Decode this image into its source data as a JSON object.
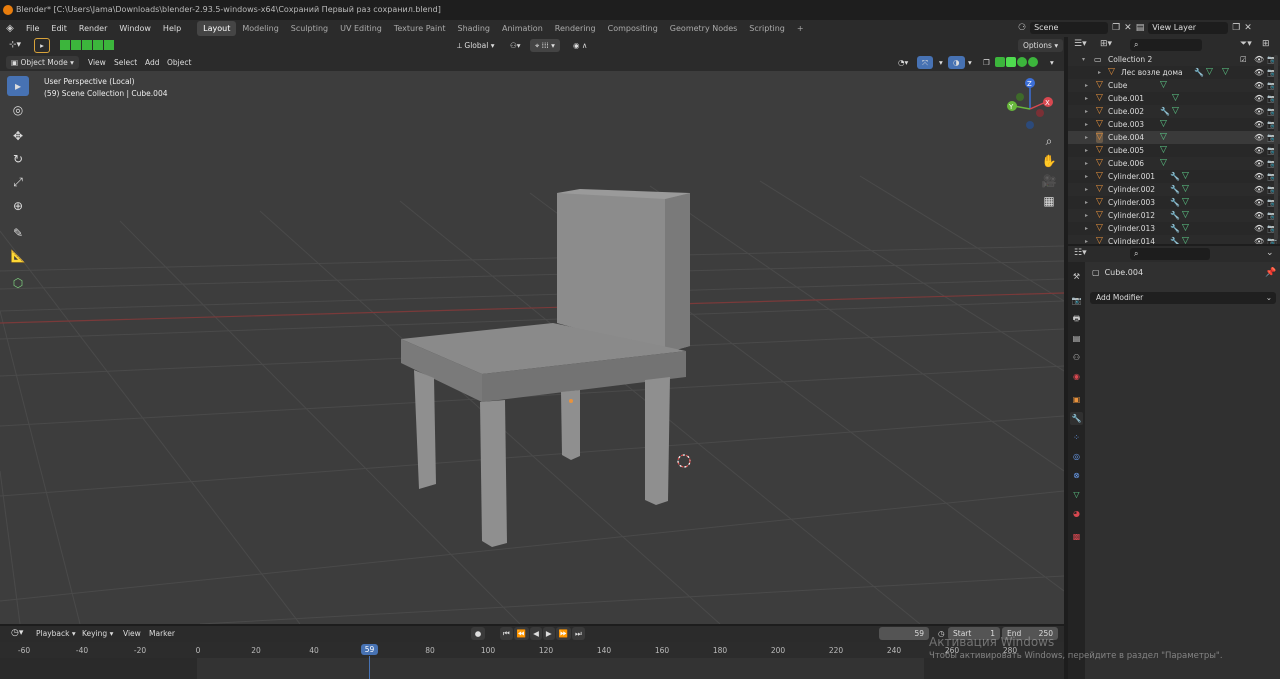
{
  "window": {
    "title": "Blender* [C:\\Users\\Jama\\Downloads\\blender-2.93.5-windows-x64\\Сохраний Первый раз сохранил.blend]"
  },
  "menubar": {
    "menus": [
      "File",
      "Edit",
      "Render",
      "Window",
      "Help"
    ],
    "workspaces": [
      "Layout",
      "Modeling",
      "Sculpting",
      "UV Editing",
      "Texture Paint",
      "Shading",
      "Animation",
      "Rendering",
      "Compositing",
      "Geometry Nodes",
      "Scripting"
    ],
    "active_workspace": "Layout",
    "scene": "Scene",
    "view_layer": "View Layer"
  },
  "viewport_header": {
    "transform": "Global",
    "options": "Options",
    "mode": "Object Mode",
    "menus": [
      "View",
      "Select",
      "Add",
      "Object"
    ]
  },
  "viewport": {
    "perspective": "User Perspective (Local)",
    "collection": "(59) Scene Collection | Cube.004",
    "axes": {
      "x": "X",
      "y": "Y",
      "z": "Z"
    }
  },
  "outliner": {
    "search_placeholder": "",
    "collection": "Collection 2",
    "rows": [
      {
        "name": "Лес возле дома",
        "modifier": true
      },
      {
        "name": "Cube",
        "modifier": false
      },
      {
        "name": "Cube.001",
        "modifier": false
      },
      {
        "name": "Cube.002",
        "modifier": true
      },
      {
        "name": "Cube.003",
        "modifier": false
      },
      {
        "name": "Cube.004",
        "modifier": false,
        "selected": true
      },
      {
        "name": "Cube.005",
        "modifier": false
      },
      {
        "name": "Cube.006",
        "modifier": false
      },
      {
        "name": "Cylinder.001",
        "modifier": true
      },
      {
        "name": "Cylinder.002",
        "modifier": true
      },
      {
        "name": "Cylinder.003",
        "modifier": true
      },
      {
        "name": "Cylinder.012",
        "modifier": true
      },
      {
        "name": "Cylinder.013",
        "modifier": true
      },
      {
        "name": "Cylinder.014",
        "modifier": true
      }
    ]
  },
  "properties": {
    "object_name": "Cube.004",
    "add_modifier": "Add Modifier"
  },
  "timeline": {
    "menus": [
      "Playback",
      "Keying",
      "View",
      "Marker"
    ],
    "current_frame": "59",
    "start_label": "Start",
    "start": "1",
    "end_label": "End",
    "end": "250",
    "ticks": [
      "-60",
      "-40",
      "-20",
      "0",
      "20",
      "40",
      "59",
      "80",
      "100",
      "120",
      "140",
      "160",
      "180",
      "200",
      "220",
      "240",
      "260",
      "280"
    ]
  },
  "watermark": {
    "title": "Активация Windows",
    "text": "Чтобы активировать Windows, перейдите в раздел \"Параметры\"."
  },
  "colors": {
    "accent": "#4772b3",
    "object_orange": "#e8923d",
    "mesh_green": "#5fce8a",
    "viewport_bg": "#3d3d3d"
  }
}
